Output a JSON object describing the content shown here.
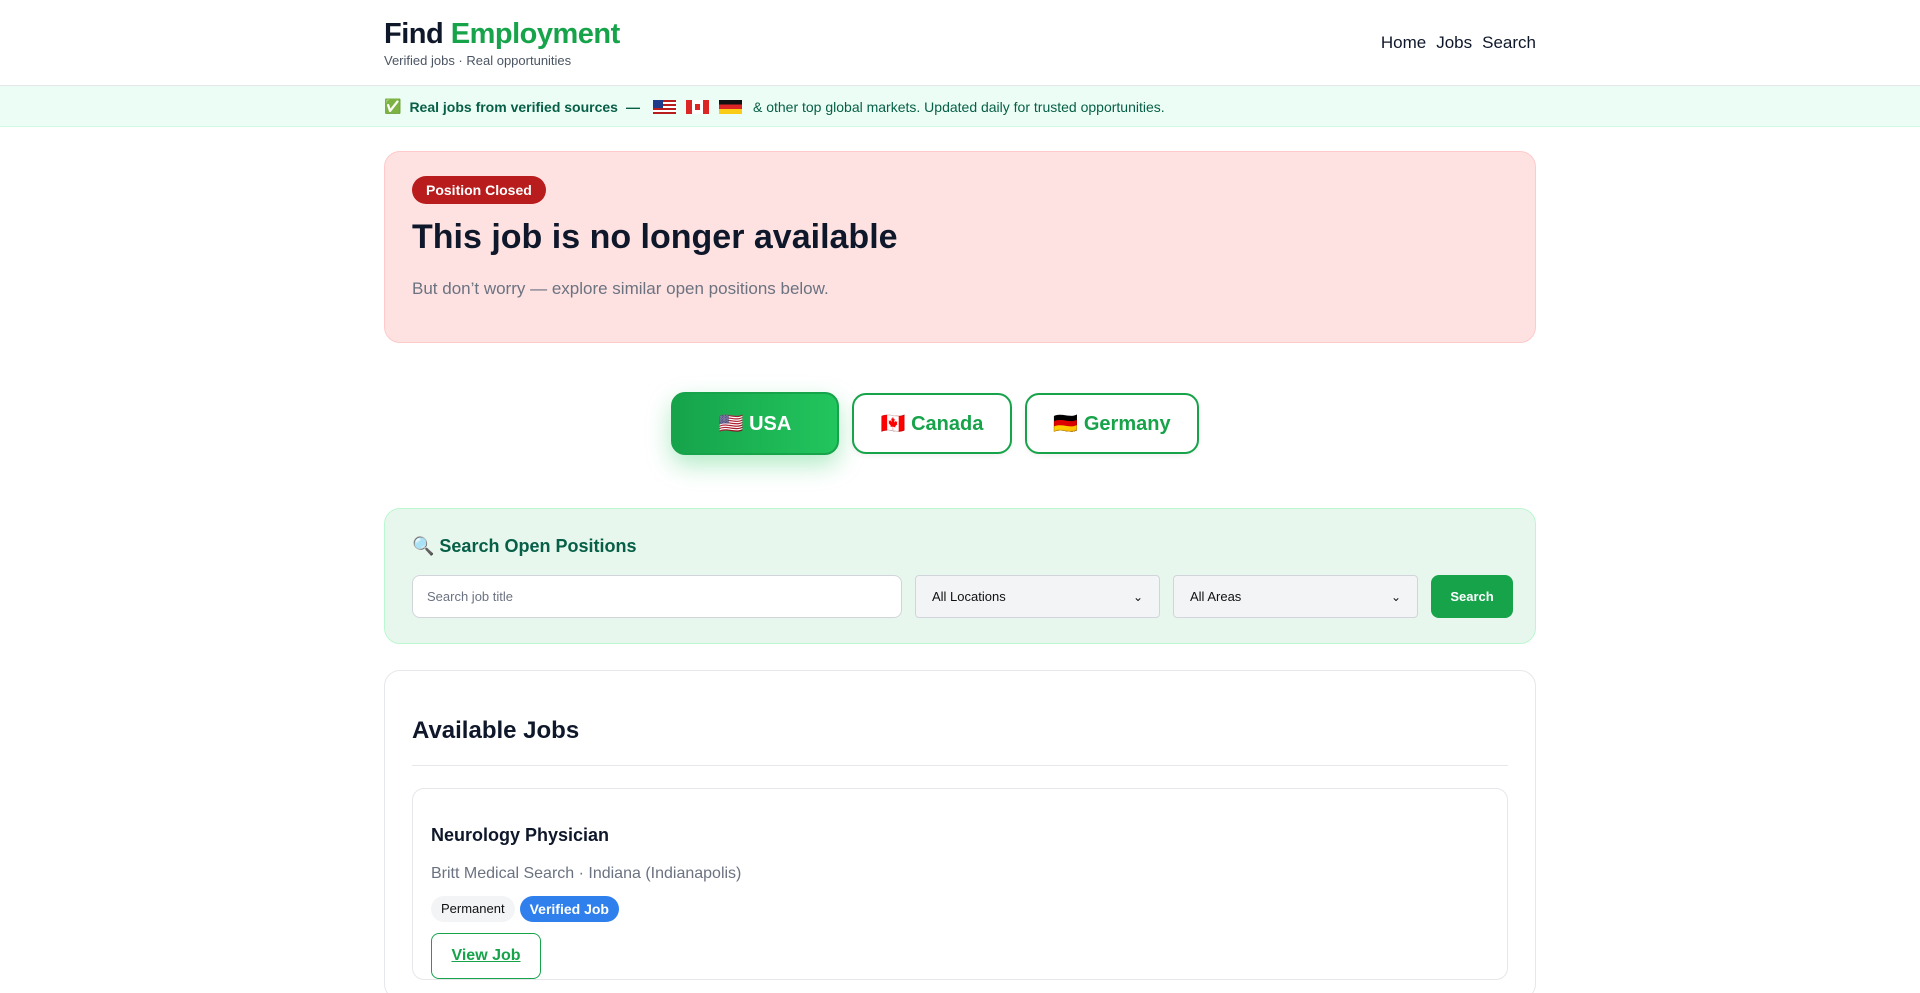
{
  "header": {
    "logo_part1": "Find",
    "logo_part2": "Employment",
    "tagline": "Verified jobs · Real opportunities",
    "nav": [
      "Home",
      "Jobs",
      "Search"
    ]
  },
  "banner": {
    "icon": "✅",
    "bold": "Real jobs from verified sources",
    "separator": "—",
    "rest": "& other top global markets. Updated daily for trusted opportunities."
  },
  "closed": {
    "badge": "Position Closed",
    "title": "This job is no longer available",
    "subtitle": "But don’t worry — explore similar open positions below."
  },
  "countries": [
    {
      "label": "🇺🇸 USA",
      "active": true
    },
    {
      "label": "🇨🇦 Canada",
      "active": false
    },
    {
      "label": "🇩🇪 Germany",
      "active": false
    }
  ],
  "search": {
    "title": "🔍 Search Open Positions",
    "placeholder": "Search job title",
    "location": "All Locations",
    "area": "All Areas",
    "button": "Search"
  },
  "jobs": {
    "title": "Available Jobs",
    "items": [
      {
        "title": "Neurology Physician",
        "meta": "Britt Medical Search · Indiana (Indianapolis)",
        "tag1": "Permanent",
        "tag2": "Verified Job",
        "action": "View Job"
      }
    ]
  }
}
